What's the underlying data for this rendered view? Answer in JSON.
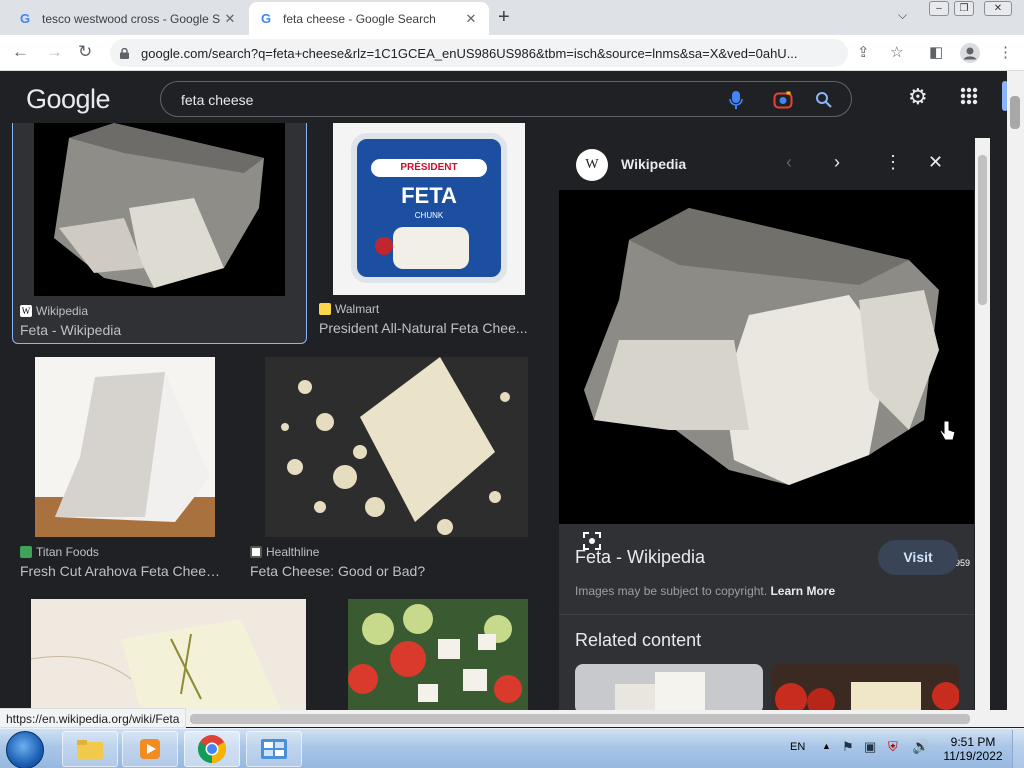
{
  "browser": {
    "tabs": [
      {
        "title": "tesco westwood cross - Google S",
        "active": false
      },
      {
        "title": "feta cheese - Google Search",
        "active": true
      }
    ],
    "url": "google.com/search?q=feta+cheese&rlz=1C1GCEA_enUS986US986&tbm=isch&source=lnms&sa=X&ved=0ahU..."
  },
  "google": {
    "logo": "Google",
    "query": "feta cheese"
  },
  "results": [
    {
      "source": "Wikipedia",
      "title": "Feta - Wikipedia"
    },
    {
      "source": "Walmart",
      "title": "President All-Natural Feta Chee..."
    },
    {
      "source": "Titan Foods",
      "title": "Fresh Cut Arahova Feta Chees..."
    },
    {
      "source": "Healthline",
      "title": "Feta Cheese: Good or Bad?"
    }
  ],
  "walmart_pack": {
    "brand": "PRÉSIDENT",
    "product": "FETA",
    "variant": "CHUNK"
  },
  "preview": {
    "site": "Wikipedia",
    "site_logo": "W",
    "dimensions": "1,199 × 959",
    "title": "Feta - Wikipedia",
    "visit_label": "Visit",
    "copyright": "Images may be subject to copyright.",
    "learn_more": "Learn More",
    "related_heading": "Related content"
  },
  "status_url": "https://en.wikipedia.org/wiki/Feta",
  "taskbar": {
    "language": "EN",
    "time": "9:51 PM",
    "date": "11/19/2022"
  },
  "colors": {
    "dark_bg": "#202124",
    "panel_bg": "#303134",
    "accent": "#8ab4f8"
  }
}
